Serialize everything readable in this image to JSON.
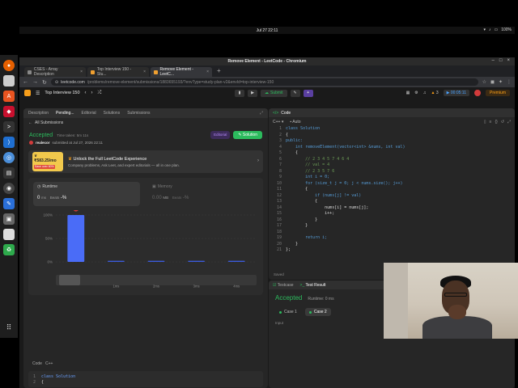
{
  "topbar": {
    "clock": "Jul 27  22:11",
    "battery": "100%"
  },
  "window": {
    "title": "Remove Element - LeetCode - Chromium"
  },
  "tabs": [
    {
      "label": "CSES - Array Description"
    },
    {
      "label": "Top Interview 150 - Stu..."
    },
    {
      "label": "Remove Element - LeetC..."
    }
  ],
  "address": {
    "domain": "leetcode.com",
    "path": "/problems/remove-element/submissions/1883655193/?envType=study-plan-v2&envId=top-interview-150"
  },
  "lcnav": {
    "list_title": "Top Interview 150",
    "submit_label": "Submit",
    "streak": "3",
    "timer": "00:05:11",
    "premium_label": "Premium"
  },
  "left": {
    "tabs": [
      "Description",
      "Pending...",
      "Editorial",
      "Solutions",
      "Submissions"
    ],
    "all_submissions": "All Submissions",
    "status": "Accepted",
    "tests_passed": "Time taken: 5m 11s",
    "editorial_label": "Editorial",
    "solution_label": "Solution",
    "user": "realecor",
    "submitted_at": "submitted at Jul 27, 2026 22:11",
    "promo": {
      "price": "₹583.25",
      "price_suffix": "/mo",
      "save": "Save over 60%",
      "title": "Unlock the Full LeetCode Experience",
      "subtitle": "Company problems, Ask Leet, and expert editorials — all in one plan."
    },
    "runtime": {
      "label": "Runtime",
      "value": "0",
      "unit": "ms",
      "beats_label": "Beats",
      "beats_value": "-%"
    },
    "memory": {
      "label": "Memory",
      "value": "0.00",
      "unit": "MB",
      "beats_label": "Beats",
      "beats_value": "-%"
    },
    "code_label": "Code",
    "lang": "C++",
    "preview": [
      "class Solution",
      "{"
    ]
  },
  "editor": {
    "header": "Code",
    "lang": "C++",
    "mode": "Auto",
    "saved": "Saved",
    "lines": [
      "class Solution",
      "{",
      "public:",
      "    int removeElement(vector<int> &nums, int val)",
      "    {",
      "        // 2 3 4 5 7 4 6 4",
      "        // val = 4",
      "        // 2 3 5 7 6",
      "        int i = 0;",
      "        for (size_t j = 0; j < nums.size(); j++)",
      "        {",
      "            if (nums[j] != val)",
      "            {",
      "                nums[i] = nums[j];",
      "                i++;",
      "            }",
      "        }",
      "",
      "        return i;",
      "    }",
      "};"
    ]
  },
  "result": {
    "tabs": [
      "Testcase",
      "Test Result"
    ],
    "status": "Accepted",
    "runtime": "Runtime: 0 ms",
    "cases": [
      "Case 1",
      "Case 2"
    ],
    "input_label": "Input"
  },
  "chart_data": {
    "type": "bar",
    "ytick_labels": [
      "100%",
      "50%",
      "0%"
    ],
    "xtick_labels": [
      "1ms",
      "2ms",
      "3ms",
      "4ms"
    ],
    "values": [
      100,
      0.5,
      0.5,
      0.5,
      0.5
    ],
    "ylim": [
      0,
      100
    ],
    "highlight_index": 0,
    "colors": {
      "highlight": "#4a6cf7",
      "bar": "#3b5bdb"
    }
  }
}
